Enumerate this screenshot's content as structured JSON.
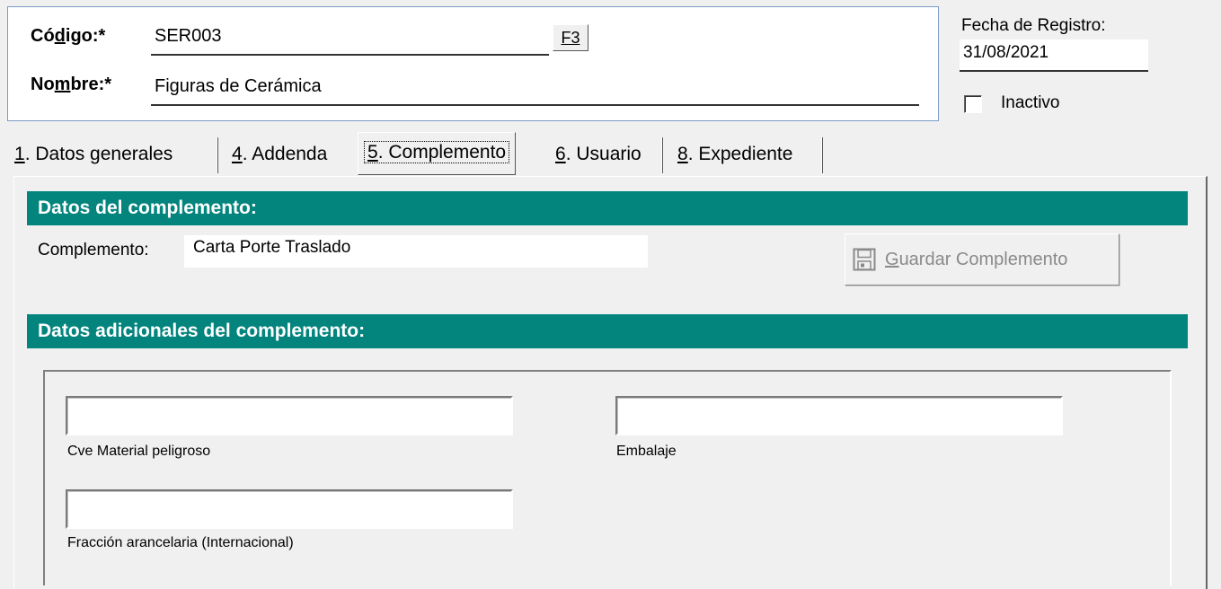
{
  "header": {
    "codigo_label": "Código:*",
    "codigo_value": "SER003",
    "f3_label": "F3",
    "nombre_label": "Nombre:*",
    "nombre_value": "Figuras de Cerámica",
    "fecha_label": "Fecha de Registro:",
    "fecha_value": "31/08/2021",
    "inactivo_label": "Inactivo",
    "inactivo_checked": false
  },
  "tabs": [
    {
      "label": "1. Datos generales",
      "active": false
    },
    {
      "label": "4. Addenda",
      "active": false
    },
    {
      "label": "5. Complemento",
      "active": true
    },
    {
      "label": "6. Usuario",
      "active": false
    },
    {
      "label": "8. Expediente",
      "active": false
    }
  ],
  "complemento_section": {
    "title": "Datos del complemento:",
    "complemento_label": "Complemento:",
    "complemento_value": "Carta Porte Traslado",
    "guardar_label": "Guardar Complemento",
    "guardar_enabled": false
  },
  "adicionales_section": {
    "title": "Datos adicionales del complemento:",
    "fields": [
      {
        "label": "Cve Material peligroso",
        "value": ""
      },
      {
        "label": "Embalaje",
        "value": ""
      },
      {
        "label": "Fracción arancelaria (Internacional)",
        "value": ""
      }
    ]
  },
  "colors": {
    "section_bar": "#03857e",
    "header_border": "#7a9cc6",
    "window_bg": "#f0f0f0"
  },
  "icons": {
    "guardar": "floppy-disk-icon"
  }
}
